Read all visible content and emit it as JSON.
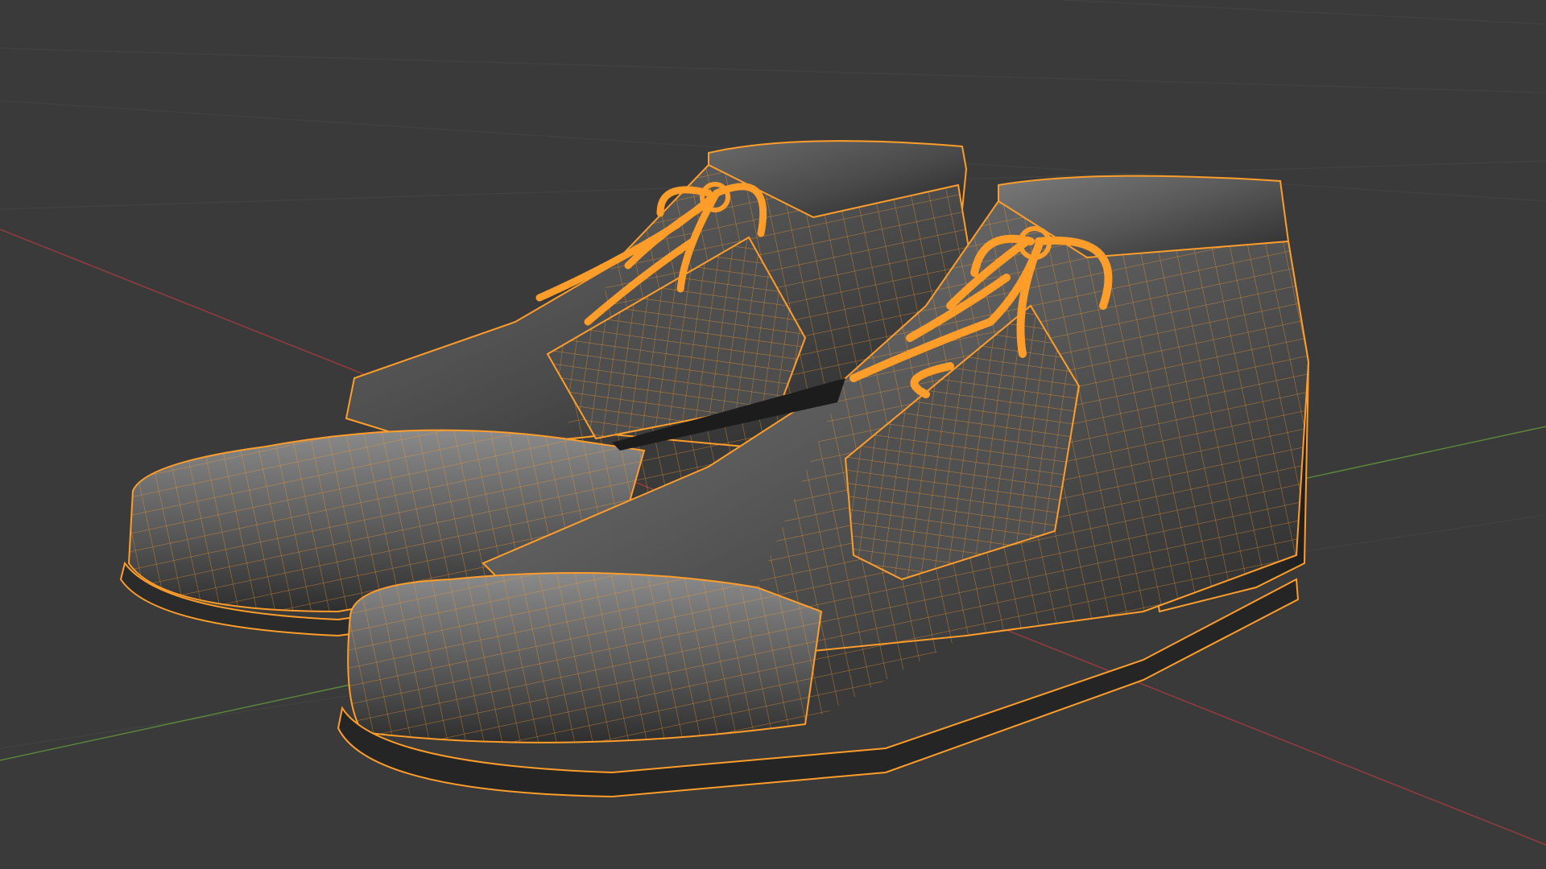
{
  "viewport": {
    "shading_mode": "solid-with-wireframe-overlay",
    "selected_objects": [
      "shoe-left",
      "shoe-right",
      "lace-left",
      "lace-right"
    ],
    "axes": {
      "x_axis_color": "#9b3b3f",
      "y_axis_color": "#5b8a3a"
    },
    "colors": {
      "background": "#3a3a3a",
      "grid_line": "#434343",
      "mesh_fill_light": "#6e6e6e",
      "mesh_fill_dark": "#262626",
      "selection_wire": "#ff9d2a"
    }
  }
}
